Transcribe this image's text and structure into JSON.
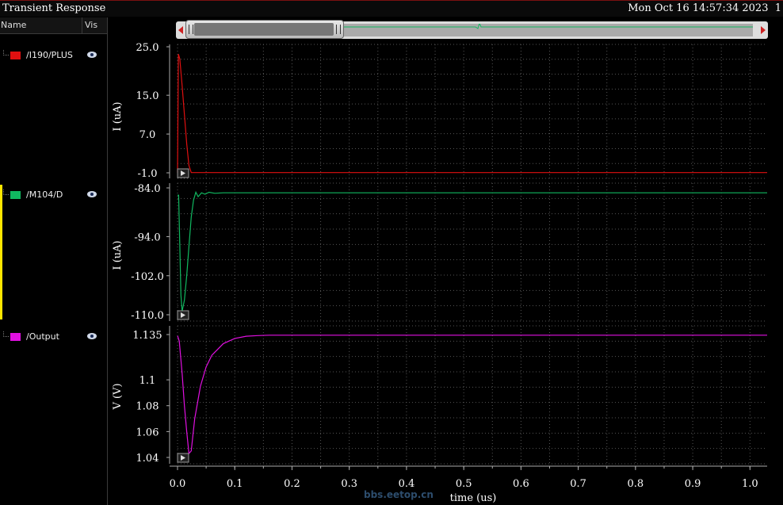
{
  "window": {
    "title": "Transient Response",
    "timestamp": "Mon Oct 16 14:57:34 2023  1"
  },
  "sidebar": {
    "header": {
      "name": "Name",
      "vis": "Vis"
    },
    "traces": [
      {
        "label": "/I190/PLUS",
        "color": "#e01010"
      },
      {
        "label": "/M104/D",
        "color": "#10b860"
      },
      {
        "label": "/Output",
        "color": "#e010e0"
      }
    ]
  },
  "icons": {
    "visibility": "eye-icon",
    "play": "play-icon",
    "scroll_left": "arrow-left-icon",
    "scroll_right": "arrow-right-icon"
  },
  "chart_data": {
    "type": "line",
    "xlabel": "time (us)",
    "xlim": [
      0,
      1.03
    ],
    "xticks": [
      "0.0",
      "0.1",
      "0.2",
      "0.3",
      "0.4",
      "0.5",
      "0.6",
      "0.7",
      "0.8",
      "0.9",
      "1.0"
    ],
    "panels": [
      {
        "ylabel": "I (uA)",
        "ylim": [
          -1.0,
          25.0
        ],
        "yticks": [
          {
            "label": "25.0",
            "value": 25.0
          },
          {
            "label": "15.0",
            "value": 15.0
          },
          {
            "label": "7.0",
            "value": 7.0
          },
          {
            "label": "-1.0",
            "value": -1.0
          }
        ],
        "series": [
          {
            "color": "#e01010",
            "x": [
              0,
              0.0015,
              0.004,
              0.008,
              0.012,
              0.016,
              0.02,
              0.024,
              1.03
            ],
            "y": [
              -1.0,
              23.5,
              22.5,
              17,
              11,
              5,
              0.5,
              -0.95,
              -0.95
            ]
          }
        ]
      },
      {
        "ylabel": "I (uA)",
        "ylim": [
          -110.0,
          -84.0
        ],
        "yticks": [
          {
            "label": "-84.0",
            "value": -84.0
          },
          {
            "label": "-94.0",
            "value": -94.0
          },
          {
            "label": "-102.0",
            "value": -102.0
          },
          {
            "label": "-110.0",
            "value": -110.0
          }
        ],
        "series": [
          {
            "color": "#10b860",
            "x": [
              0,
              0.002,
              0.004,
              0.006,
              0.008,
              0.012,
              0.016,
              0.02,
              0.024,
              0.028,
              0.032,
              0.036,
              0.042,
              0.048,
              0.055,
              0.065,
              0.08,
              1.03
            ],
            "y": [
              -85.5,
              -85.5,
              -96,
              -106,
              -109.3,
              -107,
              -102,
              -96,
              -90,
              -86.5,
              -84.9,
              -85.8,
              -85.0,
              -85.3,
              -84.9,
              -85.1,
              -85.0,
              -85.0
            ]
          }
        ]
      },
      {
        "ylabel": "V (V)",
        "ylim": [
          1.04,
          1.135
        ],
        "yticks": [
          {
            "label": "1.135",
            "value": 1.135
          },
          {
            "label": "1.1",
            "value": 1.1
          },
          {
            "label": "1.08",
            "value": 1.08
          },
          {
            "label": "1.06",
            "value": 1.06
          },
          {
            "label": "1.04",
            "value": 1.04
          }
        ],
        "series": [
          {
            "color": "#e010e0",
            "x": [
              0,
              0.003,
              0.008,
              0.012,
              0.016,
              0.02,
              0.024,
              0.03,
              0.04,
              0.05,
              0.06,
              0.08,
              0.1,
              0.12,
              0.14,
              0.16,
              1.03
            ],
            "y": [
              1.134,
              1.13,
              1.105,
              1.08,
              1.06,
              1.043,
              1.045,
              1.07,
              1.095,
              1.11,
              1.119,
              1.128,
              1.132,
              1.1337,
              1.1342,
              1.1345,
              1.1345
            ]
          }
        ]
      }
    ]
  },
  "watermark": "bbs.eetop.cn"
}
